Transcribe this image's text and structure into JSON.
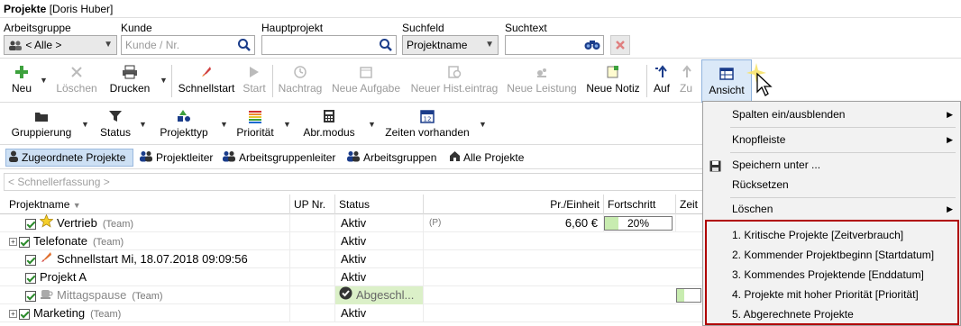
{
  "window": {
    "title": "Projekte",
    "user": "[Doris Huber]"
  },
  "filters": {
    "arbeitsgruppe": {
      "label": "Arbeitsgruppe",
      "value": "< Alle >"
    },
    "kunde": {
      "label": "Kunde",
      "placeholder": "Kunde / Nr."
    },
    "hauptprojekt": {
      "label": "Hauptprojekt",
      "value": ""
    },
    "suchfeld": {
      "label": "Suchfeld",
      "value": "Projektname"
    },
    "suchtext": {
      "label": "Suchtext",
      "value": ""
    }
  },
  "toolbar": {
    "neu": "Neu",
    "loeschen": "Löschen",
    "drucken": "Drucken",
    "schnellstart": "Schnellstart",
    "start": "Start",
    "nachtrag": "Nachtrag",
    "neue_aufgabe": "Neue Aufgabe",
    "neuer_hist": "Neuer Hist.eintrag",
    "neue_leistung": "Neue Leistung",
    "neue_notiz": "Neue Notiz",
    "auf": "Auf",
    "zu": "Zu",
    "ansicht": "Ansicht"
  },
  "toolbar2": {
    "gruppierung": "Gruppierung",
    "status": "Status",
    "projekttyp": "Projekttyp",
    "prioritaet": "Priorität",
    "abrmodus": "Abr.modus",
    "zeiten": "Zeiten vorhanden"
  },
  "tabs": [
    "Zugeordnete Projekte",
    "Projektleiter",
    "Arbeitsgruppenleiter",
    "Arbeitsgruppen",
    "Alle Projekte"
  ],
  "quick_entry": "< Schnellerfassung >",
  "grid": {
    "headers": {
      "name": "Projektname",
      "up": "UP Nr.",
      "status": "Status",
      "price": "Pr./Einheit",
      "progress": "Fortschritt",
      "time": "Zeit"
    },
    "rows": [
      {
        "name": "Vertrieb",
        "team": "(Team)",
        "status": "Aktiv",
        "flag": "(P)",
        "price": "6,60 €",
        "progress_text": "20%",
        "progress": 0.2
      },
      {
        "name": "Telefonate",
        "team": "(Team)",
        "status": "Aktiv"
      },
      {
        "name": "Schnellstart Mi, 18.07.2018 09:09:56",
        "team": "",
        "status": "Aktiv"
      },
      {
        "name": "Projekt A",
        "team": "",
        "status": "Aktiv"
      },
      {
        "name": "Mittagspause",
        "team": "(Team)",
        "status": "Abgeschl..."
      },
      {
        "name": "Marketing",
        "team": "(Team)",
        "status": "Aktiv"
      }
    ]
  },
  "menu": {
    "spalten": "Spalten ein/ausblenden",
    "knopfleiste": "Knopfleiste",
    "speichern": "Speichern unter ...",
    "ruecksetzen": "Rücksetzen",
    "loeschen": "Löschen",
    "views": [
      "1. Kritische Projekte [Zeitverbrauch]",
      "2. Kommender Projektbeginn [Startdatum]",
      "3. Kommendes Projektende [Enddatum]",
      "4. Projekte mit hoher Priorität [Priorität]",
      "5. Abgerechnete Projekte"
    ]
  }
}
